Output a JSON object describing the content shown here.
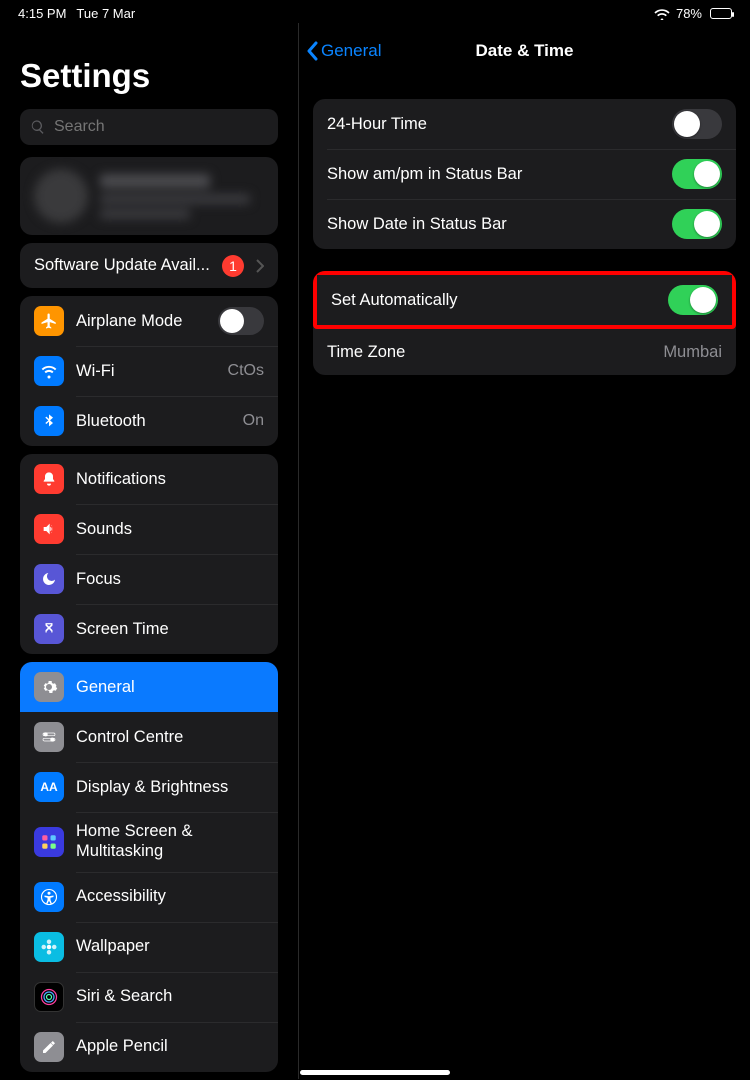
{
  "status": {
    "time": "4:15 PM",
    "date": "Tue 7 Mar",
    "battery_pct": "78%",
    "battery_fill": 78
  },
  "sidebar": {
    "title": "Settings",
    "search_placeholder": "Search",
    "update_row": {
      "label": "Software Update Avail...",
      "badge": "1"
    },
    "conn": {
      "airplane": "Airplane Mode",
      "wifi": "Wi-Fi",
      "wifi_value": "CtOs",
      "bluetooth": "Bluetooth",
      "bt_value": "On"
    },
    "g2": {
      "notifications": "Notifications",
      "sounds": "Sounds",
      "focus": "Focus",
      "screentime": "Screen Time"
    },
    "g3": {
      "general": "General",
      "control_centre": "Control Centre",
      "display": "Display & Brightness",
      "home": "Home Screen & Multitasking",
      "accessibility": "Accessibility",
      "wallpaper": "Wallpaper",
      "siri": "Siri & Search",
      "pencil": "Apple Pencil"
    }
  },
  "main": {
    "back": "General",
    "title": "Date & Time",
    "g1": {
      "twentyfour": "24-Hour Time",
      "ampm": "Show am/pm in Status Bar",
      "showdate": "Show Date in Status Bar"
    },
    "g2": {
      "auto": "Set Automatically",
      "tz_label": "Time Zone",
      "tz_value": "Mumbai"
    }
  }
}
